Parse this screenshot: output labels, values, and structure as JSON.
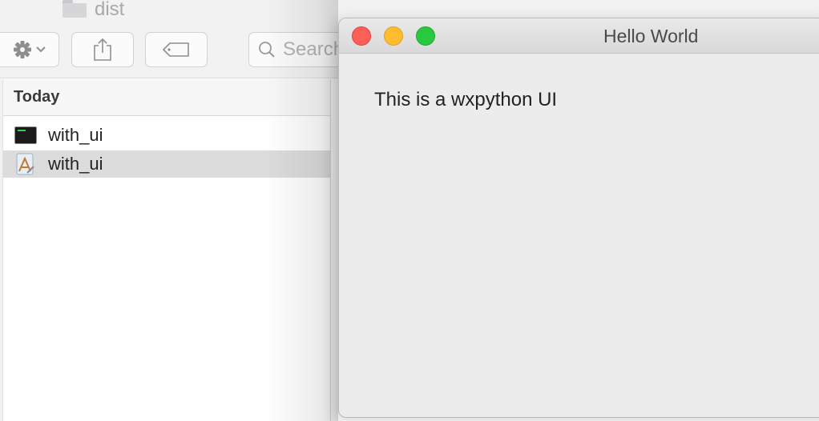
{
  "finder": {
    "folder_name": "dist",
    "search": {
      "placeholder": "Search"
    },
    "list": {
      "section_header": "Today",
      "items": [
        {
          "name": "with_ui",
          "icon": "terminal-executable-icon",
          "selected": false
        },
        {
          "name": "with_ui",
          "icon": "app-bundle-icon",
          "selected": true
        }
      ]
    },
    "toolbar": {
      "action_icon": "gear-icon",
      "share_icon": "share-icon",
      "tags_icon": "tag-icon",
      "search_icon": "search-icon"
    }
  },
  "app_window": {
    "title": "Hello World",
    "message": "This is a wxpython UI",
    "controls": {
      "close_color": "#fe5f57",
      "minimize_color": "#febc2e",
      "zoom_color": "#28c840"
    }
  }
}
